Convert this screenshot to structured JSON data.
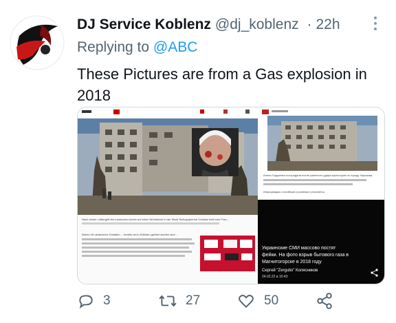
{
  "tweet": {
    "author_name": "DJ Service Koblenz",
    "author_handle": "@dj_koblenz",
    "separator": "·",
    "time": "22h",
    "replying_prefix": "Replying to",
    "replying_to": "@ABC",
    "text": "These Pictures are from a Gas explosion in 2018"
  },
  "media": {
    "left_caption": "Nach einem Luftangriff der russischen Armee auf einen Wohnblock in der Stadt Tschugujew bei Charkiw hebt eine Frau ...",
    "left_paragraph": "Neben 46 ukrainische Soldaten ... bereits zehn Zivilisten getötet worden sind ...",
    "right_caption": "Алена Гордиенко пострадала после ракетного удара агрессоров по городу Харькова.",
    "right_note": "Информация о погибших и раненых уточняется.",
    "overlay_line1": "Украинские СМИ массово постят",
    "overlay_line2": "фейки. На фото взрыв бытового газа в",
    "overlay_line3": "Магнитогорске в 2018 году",
    "overlay_author": "Сергей \"Zergulio\" Колясников",
    "overlay_date": "24.02.22 в 10:43"
  },
  "actions": {
    "replies": "3",
    "retweets": "27",
    "likes": "50"
  },
  "icons": [
    "reply-icon",
    "retweet-icon",
    "like-icon",
    "share-icon",
    "more-icon"
  ],
  "colors": {
    "link": "#1d9bf0",
    "muted": "#536471",
    "text": "#0f1419",
    "border": "#cfd9de"
  }
}
